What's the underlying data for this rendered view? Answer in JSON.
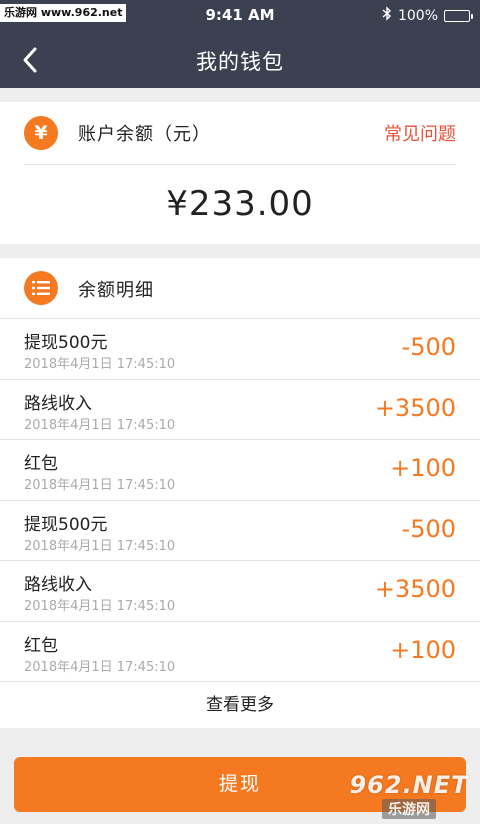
{
  "status_bar": {
    "watermark_text": "乐游网 www.962.net",
    "time": "9:41 AM",
    "bluetooth_icon": "bluetooth-icon",
    "battery_text": "100%"
  },
  "nav": {
    "title": "我的钱包",
    "back_icon": "chevron-left-icon"
  },
  "balance": {
    "icon": "yen-circle-icon",
    "icon_glyph": "¥",
    "label": "账户余额（元）",
    "faq_link": "常见问题",
    "amount": "¥233.00"
  },
  "details": {
    "icon": "list-circle-icon",
    "title": "余额明细",
    "transactions": [
      {
        "title": "提现500元",
        "time": "2018年4月1日 17:45:10",
        "amount": "-500"
      },
      {
        "title": "路线收入",
        "time": "2018年4月1日 17:45:10",
        "amount": "+3500"
      },
      {
        "title": "红包",
        "time": "2018年4月1日 17:45:10",
        "amount": "+100"
      },
      {
        "title": "提现500元",
        "time": "2018年4月1日 17:45:10",
        "amount": "-500"
      },
      {
        "title": "路线收入",
        "time": "2018年4月1日 17:45:10",
        "amount": "+3500"
      },
      {
        "title": "红包",
        "time": "2018年4月1日 17:45:10",
        "amount": "+100"
      }
    ],
    "view_more": "查看更多"
  },
  "withdraw_button": "提现",
  "site_watermark": {
    "top": "962",
    "top_suffix": ".NET",
    "bottom": "乐游网"
  },
  "colors": {
    "header_bg": "#3b4150",
    "accent": "#f47920",
    "link_red": "#e8523a",
    "page_bg": "#eeeeee"
  }
}
